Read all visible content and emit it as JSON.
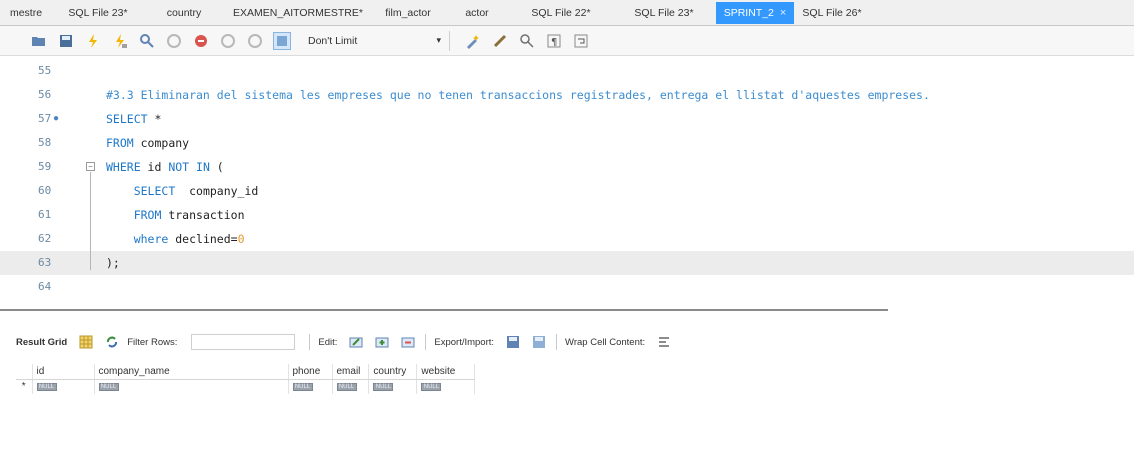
{
  "tabs": [
    {
      "label": "mestre",
      "active": false
    },
    {
      "label": "SQL File 23*",
      "active": false
    },
    {
      "label": "country",
      "active": false
    },
    {
      "label": "EXAMEN_AITORMESTRE*",
      "active": false
    },
    {
      "label": "film_actor",
      "active": false
    },
    {
      "label": "actor",
      "active": false
    },
    {
      "label": "SQL File 22*",
      "active": false
    },
    {
      "label": "SQL File 23*",
      "active": false
    },
    {
      "label": "SPRINT_2",
      "active": true
    },
    {
      "label": "SQL File 26*",
      "active": false
    }
  ],
  "active_tab_close": "×",
  "toolbar": {
    "limit_label": "Don't Limit",
    "limit_caret": "▾",
    "icons": [
      "open-folder-icon",
      "save-icon",
      "execute-icon",
      "execute-current-icon",
      "explain-icon",
      "stop-icon",
      "toggle-error-icon",
      "commit-icon",
      "rollback-icon",
      "autocommit-icon",
      "beautify-icon",
      "bookmark-icon",
      "find-icon",
      "invisible-chars-icon",
      "wrap-icon"
    ]
  },
  "editor": {
    "lines": [
      {
        "num": "55",
        "marker": "",
        "segments": []
      },
      {
        "num": "56",
        "marker": "",
        "segments": [
          {
            "t": "#3.3 Eliminaran del sistema les empreses que no tenen transaccions registrades, entrega el llistat d'aquestes empreses.",
            "c": "cm"
          }
        ]
      },
      {
        "num": "57",
        "marker": "●",
        "segments": [
          {
            "t": "SELECT",
            "c": "kw"
          },
          {
            "t": " *",
            "c": "id"
          }
        ]
      },
      {
        "num": "58",
        "marker": "",
        "segments": [
          {
            "t": "FROM",
            "c": "kw"
          },
          {
            "t": " company",
            "c": "id"
          }
        ]
      },
      {
        "num": "59",
        "marker": "",
        "segments": [
          {
            "t": "WHERE",
            "c": "kw"
          },
          {
            "t": " id ",
            "c": "id"
          },
          {
            "t": "NOT IN",
            "c": "kw"
          },
          {
            "t": " (",
            "c": "id"
          }
        ]
      },
      {
        "num": "60",
        "marker": "",
        "segments": [
          {
            "t": "    ",
            "c": "id"
          },
          {
            "t": "SELECT",
            "c": "kw"
          },
          {
            "t": "  company_id",
            "c": "id"
          }
        ]
      },
      {
        "num": "61",
        "marker": "",
        "segments": [
          {
            "t": "    ",
            "c": "id"
          },
          {
            "t": "FROM",
            "c": "kw"
          },
          {
            "t": " transaction",
            "c": "id"
          }
        ]
      },
      {
        "num": "62",
        "marker": "",
        "segments": [
          {
            "t": "    ",
            "c": "id"
          },
          {
            "t": "where",
            "c": "kw"
          },
          {
            "t": " declined=",
            "c": "id"
          },
          {
            "t": "0",
            "c": "num"
          }
        ]
      },
      {
        "num": "63",
        "marker": "",
        "segments": [
          {
            "t": ");",
            "c": "id"
          }
        ]
      },
      {
        "num": "64",
        "marker": "",
        "segments": []
      }
    ],
    "current_line": 8
  },
  "results": {
    "result_grid_label": "Result Grid",
    "filter_rows_label": "Filter Rows:",
    "filter_rows_value": "",
    "edit_label": "Edit:",
    "export_import_label": "Export/Import:",
    "wrap_label": "Wrap Cell Content:",
    "columns": [
      "id",
      "company_name",
      "phone",
      "email",
      "country",
      "website"
    ],
    "rows": [
      {
        "marker": "*",
        "cells": [
          "NULL",
          "NULL",
          "NULL",
          "NULL",
          "NULL",
          "NULL"
        ]
      }
    ]
  },
  "colors": {
    "active_tab": "#3399ff",
    "keyword": "#1e77c8",
    "comment": "#3c8ccf",
    "number": "#e69a2e",
    "line_number": "#6c8aa4"
  }
}
